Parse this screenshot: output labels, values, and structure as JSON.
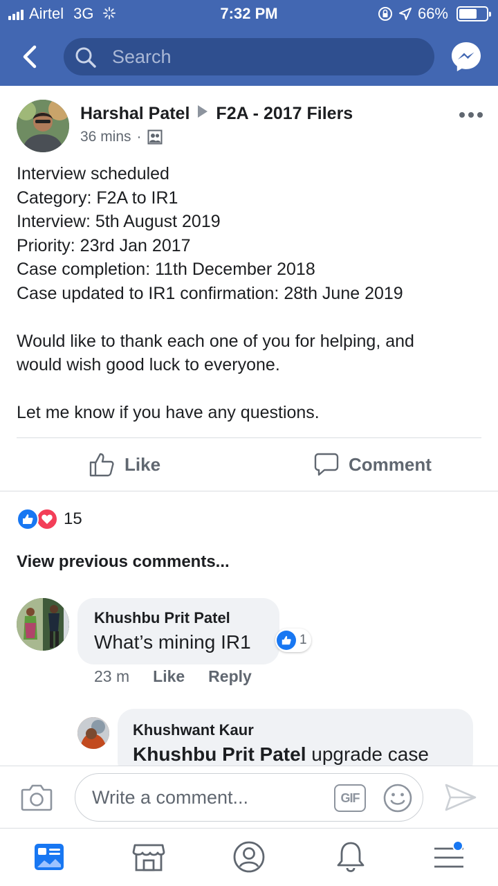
{
  "status_bar": {
    "carrier": "Airtel",
    "network": "3G",
    "time": "7:32 PM",
    "battery": "66%",
    "battery_level": 0.66
  },
  "header": {
    "search_placeholder": "Search"
  },
  "post": {
    "author": "Harshal Patel",
    "group": "F2A - 2017 Filers",
    "time": "36 mins",
    "lines": [
      "Interview scheduled",
      "Category: F2A to IR1",
      "Interview: 5th August 2019",
      "Priority: 23rd Jan 2017",
      "Case completion: 11th December 2018",
      "Case updated to IR1 confirmation: 28th June 2019"
    ],
    "para2_line1": "Would like to thank each one of you for helping, and",
    "para2_line2": "would wish good luck to everyone.",
    "para3": "Let me know if you have any questions.",
    "like_label": "Like",
    "comment_label": "Comment",
    "reaction_count": "15"
  },
  "comments": {
    "view_previous": "View previous comments...",
    "first": {
      "name": "Khushbu Prit Patel",
      "text": "What’s mining IR1",
      "like_count": "1",
      "time": "23 m",
      "like_label": "Like",
      "reply_label": "Reply"
    },
    "reply": {
      "name": "Khushwant Kaur",
      "mention": "Khushbu Prit Patel",
      "text": " upgrade case"
    }
  },
  "composer": {
    "placeholder": "Write a comment...",
    "gif_label": "GIF"
  },
  "colors": {
    "brand": "#4267b2",
    "like_blue": "#1877f2",
    "love_red": "#f33e58"
  }
}
